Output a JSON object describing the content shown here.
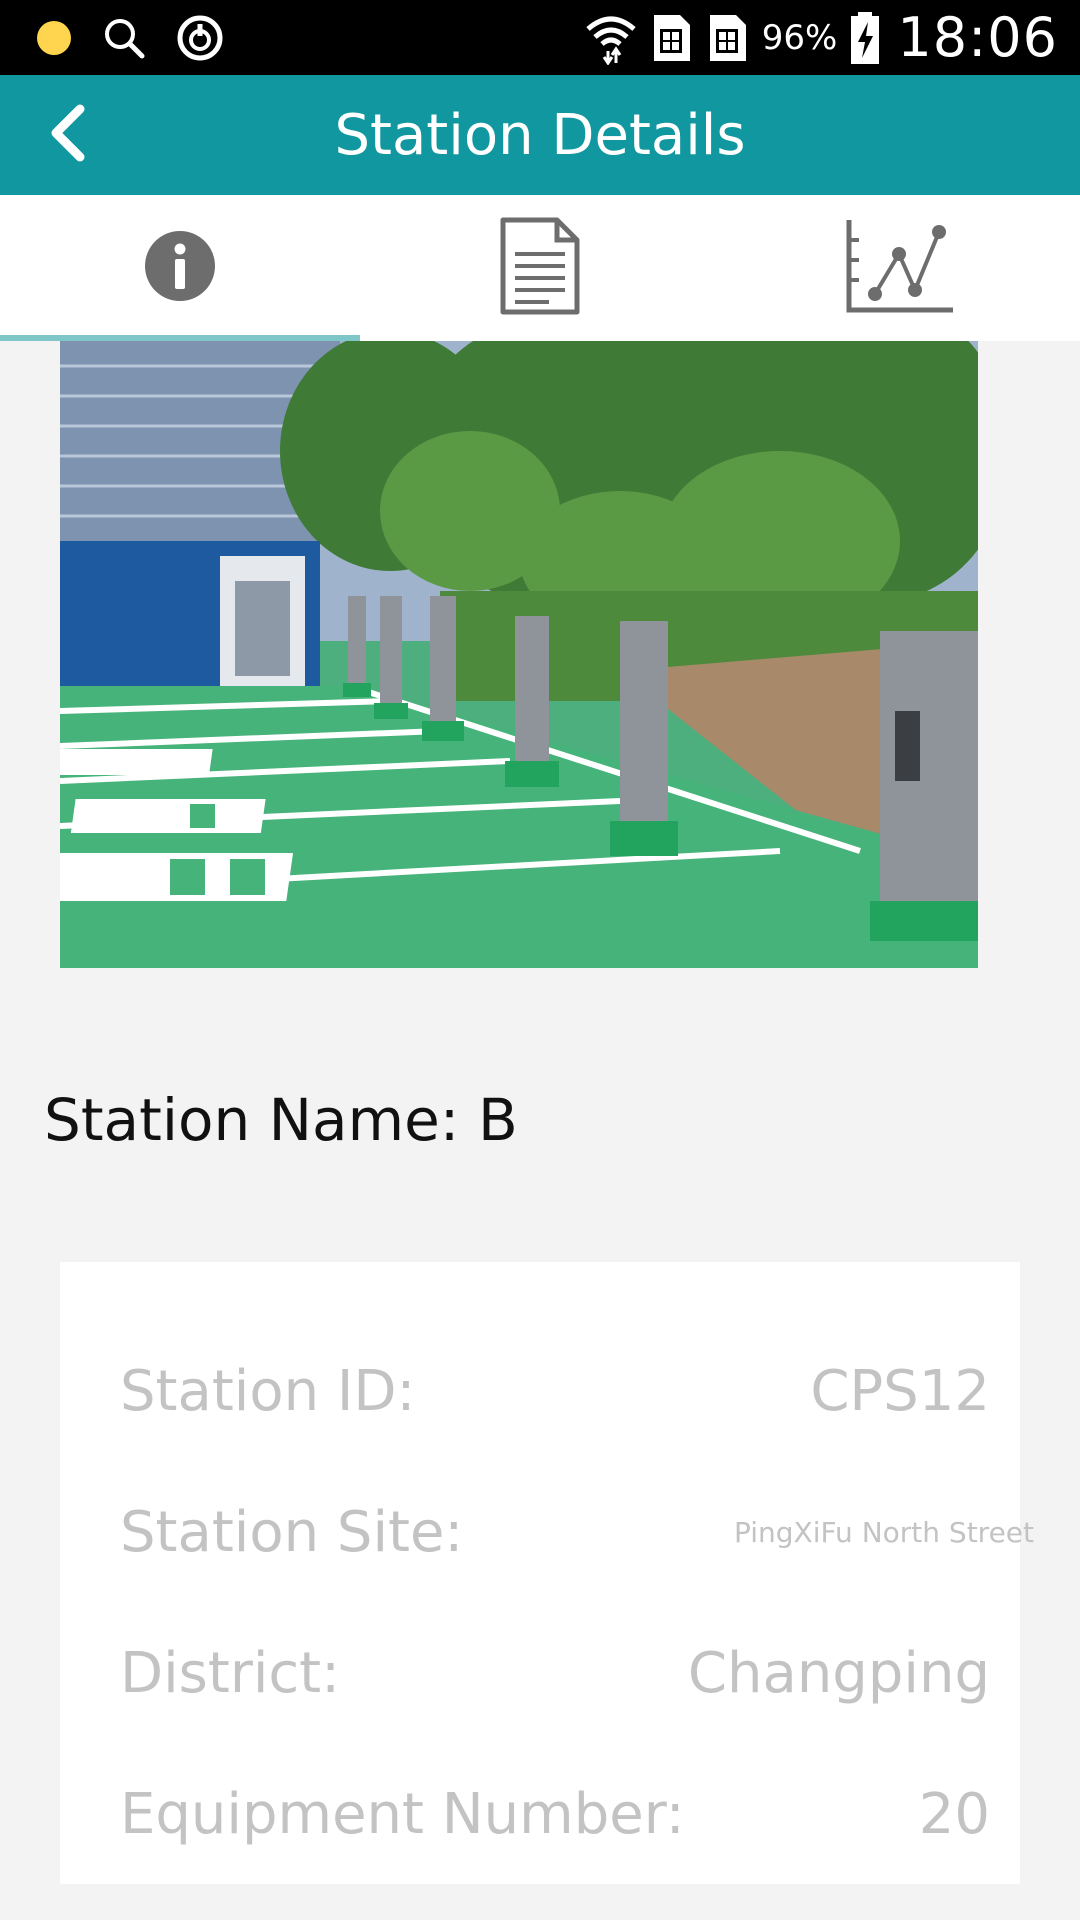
{
  "status_bar": {
    "battery_percent": "96%",
    "time": "18:06",
    "icons": [
      "notification-dot-icon",
      "search-icon",
      "power-icon",
      "wifi-icon",
      "sim1-icon",
      "sim2-icon",
      "battery-charging-icon"
    ]
  },
  "app_bar": {
    "title": "Station Details",
    "back_icon": "chevron-left-icon"
  },
  "tabs": [
    {
      "icon": "info-icon",
      "active": true
    },
    {
      "icon": "document-icon",
      "active": false
    },
    {
      "icon": "line-chart-icon",
      "active": false
    }
  ],
  "station": {
    "name_label": "Station Name:",
    "name_value": "B"
  },
  "details": {
    "id_label": "Station ID:",
    "id_value": "CPS12",
    "site_label": "Station Site:",
    "site_value": "PingXiFu North Street",
    "district_label": "District:",
    "district_value": "Changping",
    "equipment_label": "Equipment Number:",
    "equipment_value": "20"
  },
  "colors": {
    "app_bar": "#11979f",
    "tab_indicator": "#7fc6c8",
    "muted_text": "#c3c3c3"
  }
}
